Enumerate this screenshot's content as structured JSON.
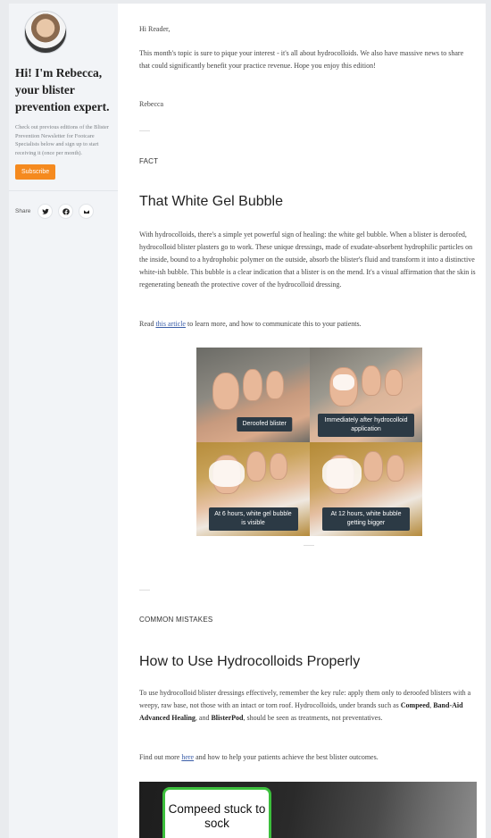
{
  "sidebar": {
    "greeting": "Hi! I'm Rebecca, your blister prevention expert.",
    "blurb": "Check out previous editions of the Blister Prevention Newsletter for Footcare Specialists below and sign up to start receiving it (once per month).",
    "subscribe_label": "Subscribe",
    "share_label": "Share",
    "share_icons": [
      "twitter-icon",
      "facebook-icon",
      "email-icon"
    ]
  },
  "intro": {
    "salutation": "Hi Reader,",
    "body": "This month's topic is sure to pique your interest - it's all about hydrocolloids. We also have massive news to share that could significantly benefit your practice revenue. Hope you enjoy this edition!",
    "signoff": "Rebecca"
  },
  "fact": {
    "label": "FACT",
    "title": "That White Gel Bubble",
    "body": "With hydrocolloids, there's a simple yet powerful sign of healing: the white gel bubble. When a blister is deroofed, hydrocolloid blister plasters go to work. These unique dressings, made of exudate-absorbent hydrophilic particles on the inside, bound to a hydrophobic polymer on the outside, absorb the blister's fluid and transform it into a distinctive white-ish bubble. This bubble is a clear indication that a blister is on the mend. It's a visual affirmation that the skin is regenerating beneath the protective cover of the hydrocolloid dressing.",
    "read_prefix": "Read ",
    "read_link": "this article",
    "read_suffix": " to learn more, and how to communicate this to your patients.",
    "captions": {
      "c1": "Deroofed blister",
      "c2": "Immediately after hydrocolloid application",
      "c3": "At 6 hours, white gel bubble is visible",
      "c4": "At 12 hours, white bubble getting bigger"
    }
  },
  "mistakes": {
    "label": "COMMON MISTAKES",
    "title": "How to Use Hydrocolloids Properly",
    "body_1": "To use hydrocolloid blister dressings effectively, remember the key rule: apply them only to deroofed blisters with a weepy, raw base, not those with an intact or torn roof. Hydrocolloids, under brands such as ",
    "brand_1": "Compeed",
    "sep_1": ", ",
    "brand_2": "Band-Aid Advanced Healing",
    "sep_2": ", and ",
    "brand_3": "BlisterPod",
    "body_2": ", should be seen as treatments, not preventatives.",
    "find_prefix": "Find out more ",
    "find_link": "here",
    "find_suffix": " and how to help your patients achieve the best blister outcomes.",
    "photo_callout": "Compeed stuck to sock"
  }
}
